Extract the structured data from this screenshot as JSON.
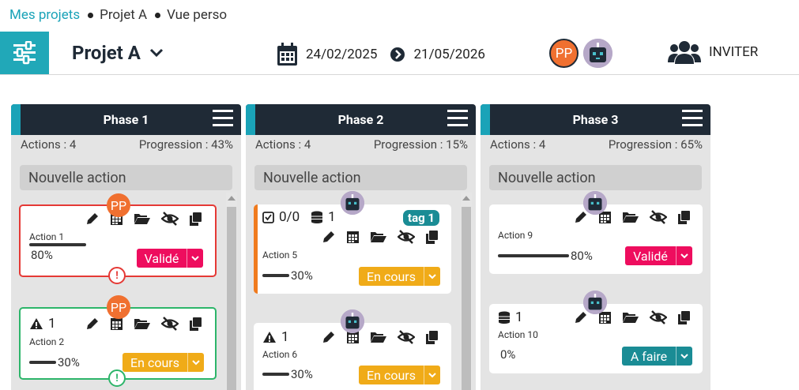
{
  "breadcrumb": {
    "root": "Mes projets",
    "project": "Projet A",
    "view": "Vue perso"
  },
  "header": {
    "project_title": "Projet A",
    "start_date": "24/02/2025",
    "end_date": "21/05/2026",
    "avatar_initials": "PP",
    "invite_label": "INVITER"
  },
  "colors": {
    "accent": "#21a8b8",
    "dark": "#1f2a36",
    "valide": "#ee0d5e",
    "en_cours": "#f0ab18",
    "a_faire": "#1a8c95",
    "danger": "#e53935",
    "success": "#2db56a"
  },
  "new_action_label": "Nouvelle action",
  "columns": [
    {
      "name": "Phase 1",
      "actions_count": "Actions : 4",
      "progression": "Progression : 43%",
      "cards": [
        {
          "title": "Action 1",
          "progress_text": "80%",
          "progress": 0.8,
          "status": "Validé",
          "assignee": "PP",
          "alert": "!"
        },
        {
          "title": "Action 2",
          "progress_text": "30%",
          "progress": 0.3,
          "status": "En cours",
          "assignee": "PP",
          "alert": "!",
          "warnings": "1"
        }
      ]
    },
    {
      "name": "Phase 2",
      "actions_count": "Actions : 4",
      "progression": "Progression : 15%",
      "cards": [
        {
          "title": "Action 5",
          "progress_text": "30%",
          "progress": 0.3,
          "status": "En cours",
          "checklist": "0/0",
          "stack": "1",
          "tag": "tag 1"
        },
        {
          "title": "Action 6",
          "progress_text": "30%",
          "progress": 0.3,
          "status": "En cours",
          "warnings": "1"
        }
      ]
    },
    {
      "name": "Phase 3",
      "actions_count": "Actions : 4",
      "progression": "Progression : 65%",
      "cards": [
        {
          "title": "Action 9",
          "progress_text": "80%",
          "progress": 0.8,
          "status": "Validé"
        },
        {
          "title": "Action 10",
          "progress_text": "0%",
          "progress": 0,
          "status": "A faire",
          "stack": "1"
        }
      ]
    }
  ]
}
